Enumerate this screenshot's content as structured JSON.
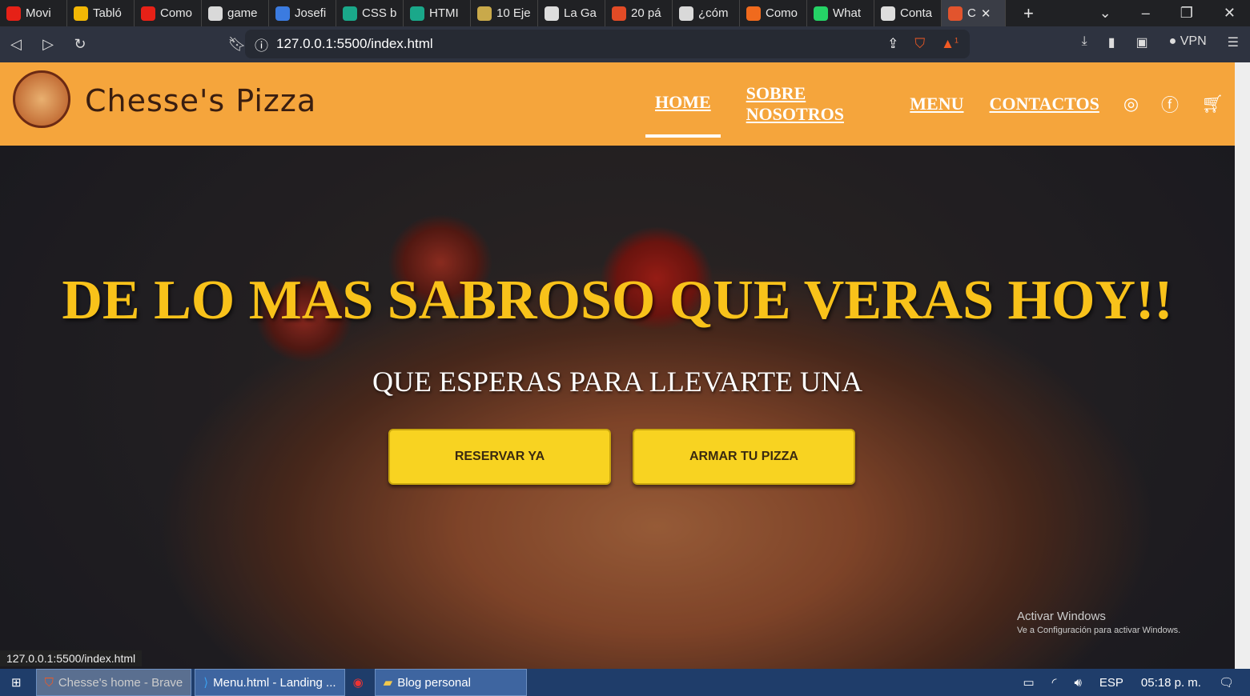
{
  "browser": {
    "tabs": [
      {
        "label": "Movi",
        "color": "#e62117"
      },
      {
        "label": "Tabló",
        "color": "#f2b705"
      },
      {
        "label": "Como",
        "color": "#e62117"
      },
      {
        "label": "game",
        "color": "#d9d9d9"
      },
      {
        "label": "Josefi",
        "color": "#3b7be0"
      },
      {
        "label": "CSS b",
        "color": "#1aa88a"
      },
      {
        "label": "HTMI",
        "color": "#1aa88a"
      },
      {
        "label": "10 Eje",
        "color": "#c9a94a"
      },
      {
        "label": "La Ga",
        "color": "#ddd"
      },
      {
        "label": "20 pá",
        "color": "#e24b26"
      },
      {
        "label": "¿cóm",
        "color": "#d9d9d9"
      },
      {
        "label": "Como",
        "color": "#f06a1d"
      },
      {
        "label": "What",
        "color": "#25d366"
      },
      {
        "label": "Conta",
        "color": "#ddd"
      },
      {
        "label": "C",
        "color": "#e2542d",
        "active": true
      }
    ],
    "new_tab": "+",
    "url": "127.0.0.1:5500/index.html",
    "vpn_label": "VPN",
    "shields_badge": "1",
    "status_url": "127.0.0.1:5500/index.html"
  },
  "site": {
    "brand": "Chesse's Pizza",
    "nav": [
      "HOME",
      "SOBRE NOSOTROS",
      "MENU",
      "CONTACTOS"
    ],
    "headline": "DE LO MAS SABROSO QUE VERAS HOY!!",
    "subheadline": "QUE ESPERAS PARA LLEVARTE UNA",
    "buttons": [
      "RESERVAR YA",
      "ARMAR TU PIZZA"
    ],
    "colors": {
      "header": "#f5a53c",
      "headline": "#f8c21a",
      "button": "#f8d321"
    }
  },
  "watermark": {
    "title": "Activar Windows",
    "subtitle": "Ve a Configuración para activar Windows."
  },
  "taskbar": {
    "items": [
      "Chesse's home - Brave",
      "Menu.html - Landing ...",
      "Blog personal"
    ],
    "language": "ESP",
    "time": "05:18 p. m."
  }
}
